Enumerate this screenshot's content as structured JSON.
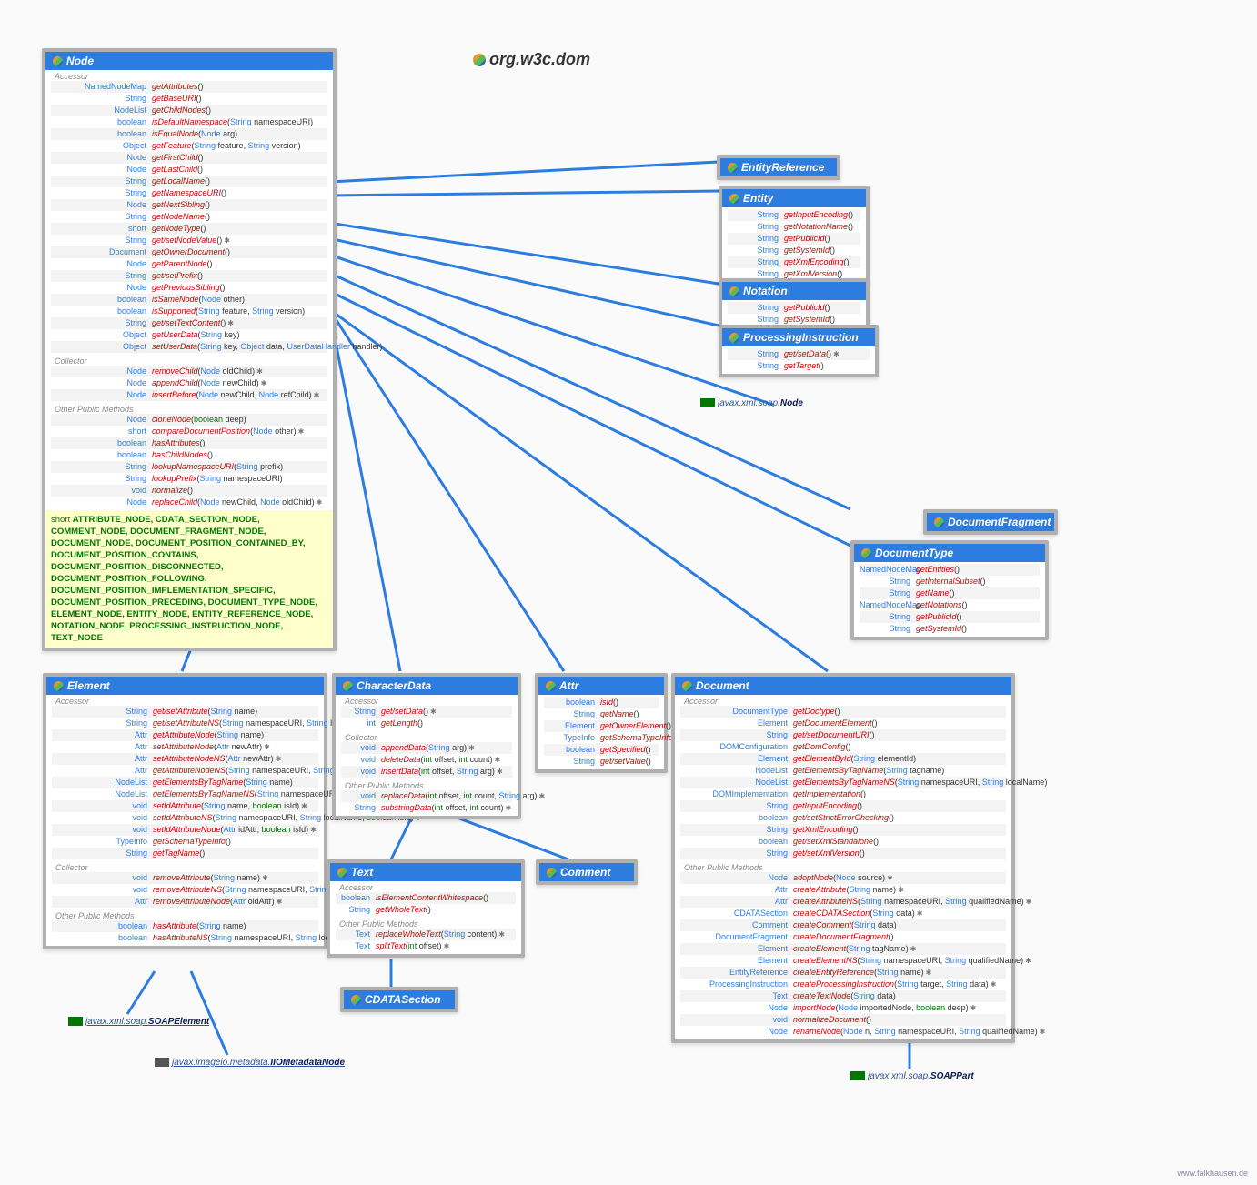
{
  "title": "org.w3c.dom",
  "footer": "www.falkhausen.de",
  "labels": {
    "accessor": "Accessor",
    "collector": "Collector",
    "other": "Other Public Methods"
  },
  "node": {
    "name": "Node",
    "accessor": [
      {
        "ret": "NamedNodeMap",
        "name": "getAttributes",
        "params": "()"
      },
      {
        "ret": "String",
        "name": "getBaseURI",
        "params": "()"
      },
      {
        "ret": "NodeList",
        "name": "getChildNodes",
        "params": "()"
      },
      {
        "ret": "boolean",
        "name": "isDefaultNamespace",
        "params": "(String namespaceURI)"
      },
      {
        "ret": "boolean",
        "name": "isEqualNode",
        "params": "(Node arg)"
      },
      {
        "ret": "Object",
        "name": "getFeature",
        "params": "(String feature, String version)"
      },
      {
        "ret": "Node",
        "name": "getFirstChild",
        "params": "()"
      },
      {
        "ret": "Node",
        "name": "getLastChild",
        "params": "()"
      },
      {
        "ret": "String",
        "name": "getLocalName",
        "params": "()"
      },
      {
        "ret": "String",
        "name": "getNamespaceURI",
        "params": "()"
      },
      {
        "ret": "Node",
        "name": "getNextSibling",
        "params": "()"
      },
      {
        "ret": "String",
        "name": "getNodeName",
        "params": "()"
      },
      {
        "ret": "short",
        "name": "getNodeType",
        "params": "()"
      },
      {
        "ret": "String",
        "name": "get/setNodeValue",
        "params": "()",
        "throws": true
      },
      {
        "ret": "Document",
        "name": "getOwnerDocument",
        "params": "()"
      },
      {
        "ret": "Node",
        "name": "getParentNode",
        "params": "()"
      },
      {
        "ret": "String",
        "name": "get/setPrefix",
        "params": "()"
      },
      {
        "ret": "Node",
        "name": "getPreviousSibling",
        "params": "()"
      },
      {
        "ret": "boolean",
        "name": "isSameNode",
        "params": "(Node other)"
      },
      {
        "ret": "boolean",
        "name": "isSupported",
        "params": "(String feature, String version)"
      },
      {
        "ret": "String",
        "name": "get/setTextContent",
        "params": "()",
        "throws": true
      },
      {
        "ret": "Object",
        "name": "getUserData",
        "params": "(String key)"
      },
      {
        "ret": "Object",
        "name": "setUserData",
        "params": "(String key, Object data, UserDataHandler handler)"
      }
    ],
    "collector": [
      {
        "ret": "Node",
        "name": "removeChild",
        "params": "(Node oldChild)",
        "throws": true
      },
      {
        "ret": "Node",
        "name": "appendChild",
        "params": "(Node newChild)",
        "throws": true
      },
      {
        "ret": "Node",
        "name": "insertBefore",
        "params": "(Node newChild, Node refChild)",
        "throws": true
      }
    ],
    "other": [
      {
        "ret": "Node",
        "name": "cloneNode",
        "params": "(boolean deep)"
      },
      {
        "ret": "short",
        "name": "compareDocumentPosition",
        "params": "(Node other)",
        "throws": true
      },
      {
        "ret": "boolean",
        "name": "hasAttributes",
        "params": "()"
      },
      {
        "ret": "boolean",
        "name": "hasChildNodes",
        "params": "()"
      },
      {
        "ret": "String",
        "name": "lookupNamespaceURI",
        "params": "(String prefix)"
      },
      {
        "ret": "String",
        "name": "lookupPrefix",
        "params": "(String namespaceURI)"
      },
      {
        "ret": "void",
        "name": "normalize",
        "params": "()"
      },
      {
        "ret": "Node",
        "name": "replaceChild",
        "params": "(Node newChild, Node oldChild)",
        "throws": true
      }
    ],
    "constants": "ATTRIBUTE_NODE, CDATA_SECTION_NODE, COMMENT_NODE, DOCUMENT_FRAGMENT_NODE, DOCUMENT_NODE, DOCUMENT_POSITION_CONTAINED_BY, DOCUMENT_POSITION_CONTAINS, DOCUMENT_POSITION_DISCONNECTED, DOCUMENT_POSITION_FOLLOWING, DOCUMENT_POSITION_IMPLEMENTATION_SPECIFIC, DOCUMENT_POSITION_PRECEDING, DOCUMENT_TYPE_NODE, ELEMENT_NODE, ENTITY_NODE, ENTITY_REFERENCE_NODE, NOTATION_NODE, PROCESSING_INSTRUCTION_NODE, TEXT_NODE"
  },
  "entityReference": {
    "name": "EntityReference"
  },
  "entity": {
    "name": "Entity",
    "methods": [
      {
        "ret": "String",
        "name": "getInputEncoding",
        "params": "()"
      },
      {
        "ret": "String",
        "name": "getNotationName",
        "params": "()"
      },
      {
        "ret": "String",
        "name": "getPublicId",
        "params": "()"
      },
      {
        "ret": "String",
        "name": "getSystemId",
        "params": "()"
      },
      {
        "ret": "String",
        "name": "getXmlEncoding",
        "params": "()"
      },
      {
        "ret": "String",
        "name": "getXmlVersion",
        "params": "()"
      }
    ]
  },
  "notation": {
    "name": "Notation",
    "methods": [
      {
        "ret": "String",
        "name": "getPublicId",
        "params": "()"
      },
      {
        "ret": "String",
        "name": "getSystemId",
        "params": "()"
      }
    ]
  },
  "pi": {
    "name": "ProcessingInstruction",
    "methods": [
      {
        "ret": "String",
        "name": "get/setData",
        "params": "()",
        "throws": true
      },
      {
        "ret": "String",
        "name": "getTarget",
        "params": "()"
      }
    ]
  },
  "documentFragment": {
    "name": "DocumentFragment"
  },
  "documentType": {
    "name": "DocumentType",
    "methods": [
      {
        "ret": "NamedNodeMap",
        "name": "getEntities",
        "params": "()"
      },
      {
        "ret": "String",
        "name": "getInternalSubset",
        "params": "()"
      },
      {
        "ret": "String",
        "name": "getName",
        "params": "()"
      },
      {
        "ret": "NamedNodeMap",
        "name": "getNotations",
        "params": "()"
      },
      {
        "ret": "String",
        "name": "getPublicId",
        "params": "()"
      },
      {
        "ret": "String",
        "name": "getSystemId",
        "params": "()"
      }
    ]
  },
  "element": {
    "name": "Element",
    "accessor": [
      {
        "ret": "String",
        "name": "get/setAttribute",
        "params": "(String name)"
      },
      {
        "ret": "String",
        "name": "get/setAttributeNS",
        "params": "(String namespaceURI, String localName)",
        "throws": true
      },
      {
        "ret": "Attr",
        "name": "getAttributeNode",
        "params": "(String name)"
      },
      {
        "ret": "Attr",
        "name": "setAttributeNode",
        "params": "(Attr newAttr)",
        "throws": true
      },
      {
        "ret": "Attr",
        "name": "setAttributeNodeNS",
        "params": "(Attr newAttr)",
        "throws": true
      },
      {
        "ret": "Attr",
        "name": "getAttributeNodeNS",
        "params": "(String namespaceURI, String localName)",
        "throws": true
      },
      {
        "ret": "NodeList",
        "name": "getElementsByTagName",
        "params": "(String name)"
      },
      {
        "ret": "NodeList",
        "name": "getElementsByTagNameNS",
        "params": "(String namespaceURI, String localName)",
        "throws": true
      },
      {
        "ret": "void",
        "name": "setIdAttribute",
        "params": "(String name, boolean isId)",
        "throws": true
      },
      {
        "ret": "void",
        "name": "setIdAttributeNS",
        "params": "(String namespaceURI, String localName, boolean isId)",
        "throws": true
      },
      {
        "ret": "void",
        "name": "setIdAttributeNode",
        "params": "(Attr idAttr, boolean isId)",
        "throws": true
      },
      {
        "ret": "TypeInfo",
        "name": "getSchemaTypeInfo",
        "params": "()"
      },
      {
        "ret": "String",
        "name": "getTagName",
        "params": "()"
      }
    ],
    "collector": [
      {
        "ret": "void",
        "name": "removeAttribute",
        "params": "(String name)",
        "throws": true
      },
      {
        "ret": "void",
        "name": "removeAttributeNS",
        "params": "(String namespaceURI, String localName)",
        "throws": true
      },
      {
        "ret": "Attr",
        "name": "removeAttributeNode",
        "params": "(Attr oldAttr)",
        "throws": true
      }
    ],
    "other": [
      {
        "ret": "boolean",
        "name": "hasAttribute",
        "params": "(String name)"
      },
      {
        "ret": "boolean",
        "name": "hasAttributeNS",
        "params": "(String namespaceURI, String localName)",
        "throws": true
      }
    ]
  },
  "characterData": {
    "name": "CharacterData",
    "accessor": [
      {
        "ret": "String",
        "name": "get/setData",
        "params": "()",
        "throws": true
      },
      {
        "ret": "int",
        "name": "getLength",
        "params": "()"
      }
    ],
    "collector": [
      {
        "ret": "void",
        "name": "appendData",
        "params": "(String arg)",
        "throws": true
      },
      {
        "ret": "void",
        "name": "deleteData",
        "params": "(int offset, int count)",
        "throws": true
      },
      {
        "ret": "void",
        "name": "insertData",
        "params": "(int offset, String arg)",
        "throws": true
      }
    ],
    "other": [
      {
        "ret": "void",
        "name": "replaceData",
        "params": "(int offset, int count, String arg)",
        "throws": true
      },
      {
        "ret": "String",
        "name": "substringData",
        "params": "(int offset, int count)",
        "throws": true
      }
    ]
  },
  "attr": {
    "name": "Attr",
    "methods": [
      {
        "ret": "boolean",
        "name": "isId",
        "params": "()"
      },
      {
        "ret": "String",
        "name": "getName",
        "params": "()"
      },
      {
        "ret": "Element",
        "name": "getOwnerElement",
        "params": "()"
      },
      {
        "ret": "TypeInfo",
        "name": "getSchemaTypeInfo",
        "params": "()"
      },
      {
        "ret": "boolean",
        "name": "getSpecified",
        "params": "()"
      },
      {
        "ret": "String",
        "name": "get/setValue",
        "params": "()"
      }
    ]
  },
  "document": {
    "name": "Document",
    "accessor": [
      {
        "ret": "DocumentType",
        "name": "getDoctype",
        "params": "()"
      },
      {
        "ret": "Element",
        "name": "getDocumentElement",
        "params": "()"
      },
      {
        "ret": "String",
        "name": "get/setDocumentURI",
        "params": "()"
      },
      {
        "ret": "DOMConfiguration",
        "name": "getDomConfig",
        "params": "()"
      },
      {
        "ret": "Element",
        "name": "getElementById",
        "params": "(String elementId)"
      },
      {
        "ret": "NodeList",
        "name": "getElementsByTagName",
        "params": "(String tagname)"
      },
      {
        "ret": "NodeList",
        "name": "getElementsByTagNameNS",
        "params": "(String namespaceURI, String localName)"
      },
      {
        "ret": "DOMImplementation",
        "name": "getImplementation",
        "params": "()"
      },
      {
        "ret": "String",
        "name": "getInputEncoding",
        "params": "()"
      },
      {
        "ret": "boolean",
        "name": "get/setStrictErrorChecking",
        "params": "()"
      },
      {
        "ret": "String",
        "name": "getXmlEncoding",
        "params": "()"
      },
      {
        "ret": "boolean",
        "name": "get/setXmlStandalone",
        "params": "()"
      },
      {
        "ret": "String",
        "name": "get/setXmlVersion",
        "params": "()"
      }
    ],
    "other": [
      {
        "ret": "Node",
        "name": "adoptNode",
        "params": "(Node source)",
        "throws": true
      },
      {
        "ret": "Attr",
        "name": "createAttribute",
        "params": "(String name)",
        "throws": true
      },
      {
        "ret": "Attr",
        "name": "createAttributeNS",
        "params": "(String namespaceURI, String qualifiedName)",
        "throws": true
      },
      {
        "ret": "CDATASection",
        "name": "createCDATASection",
        "params": "(String data)",
        "throws": true
      },
      {
        "ret": "Comment",
        "name": "createComment",
        "params": "(String data)"
      },
      {
        "ret": "DocumentFragment",
        "name": "createDocumentFragment",
        "params": "()"
      },
      {
        "ret": "Element",
        "name": "createElement",
        "params": "(String tagName)",
        "throws": true
      },
      {
        "ret": "Element",
        "name": "createElementNS",
        "params": "(String namespaceURI, String qualifiedName)",
        "throws": true
      },
      {
        "ret": "EntityReference",
        "name": "createEntityReference",
        "params": "(String name)",
        "throws": true
      },
      {
        "ret": "ProcessingInstruction",
        "name": "createProcessingInstruction",
        "params": "(String target, String data)",
        "throws": true
      },
      {
        "ret": "Text",
        "name": "createTextNode",
        "params": "(String data)"
      },
      {
        "ret": "Node",
        "name": "importNode",
        "params": "(Node importedNode, boolean deep)",
        "throws": true
      },
      {
        "ret": "void",
        "name": "normalizeDocument",
        "params": "()"
      },
      {
        "ret": "Node",
        "name": "renameNode",
        "params": "(Node n, String namespaceURI, String qualifiedName)",
        "throws": true
      }
    ]
  },
  "text": {
    "name": "Text",
    "accessor": [
      {
        "ret": "boolean",
        "name": "isElementContentWhitespace",
        "params": "()"
      },
      {
        "ret": "String",
        "name": "getWholeText",
        "params": "()"
      }
    ],
    "other": [
      {
        "ret": "Text",
        "name": "replaceWholeText",
        "params": "(String content)",
        "throws": true
      },
      {
        "ret": "Text",
        "name": "splitText",
        "params": "(int offset)",
        "throws": true
      }
    ]
  },
  "comment": {
    "name": "Comment"
  },
  "cdata": {
    "name": "CDATASection"
  },
  "ext": {
    "soapNode": {
      "pkg": "javax.xml.soap.",
      "cls": "Node"
    },
    "soapElement": {
      "pkg": "javax.xml.soap.",
      "cls": "SOAPElement"
    },
    "iio": {
      "pkg": "javax.imageio.metadata.",
      "cls": "IIOMetadataNode"
    },
    "soapPart": {
      "pkg": "javax.xml.soap.",
      "cls": "SOAPPart"
    }
  },
  "typeWords": [
    "String",
    "Node",
    "NodeList",
    "NamedNodeMap",
    "Object",
    "Document",
    "DocumentType",
    "DocumentFragment",
    "Element",
    "Attr",
    "Text",
    "Comment",
    "CDATASection",
    "EntityReference",
    "ProcessingInstruction",
    "DOMConfiguration",
    "DOMImplementation",
    "TypeInfo",
    "UserDataHandler"
  ],
  "keywordWords": [
    "boolean",
    "int",
    "short",
    "void"
  ]
}
